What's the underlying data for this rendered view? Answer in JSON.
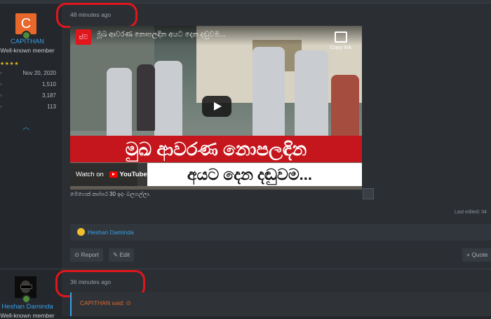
{
  "post1": {
    "time": "48 minutes ago",
    "user": {
      "avatar_letter": "C",
      "name": "CAPITHAN",
      "title": "Well-known member",
      "stars": "★★★★",
      "joined": "Nov 20, 2020",
      "messages": "1,510",
      "reactions": "3,187",
      "points": "113"
    },
    "video": {
      "channel_logo": "ස්‍ව",
      "title": "මූඛ ආවරණ නොපලඳින අයට දෙන දඬුවම...",
      "copy_link": "Copy link",
      "banner_line1": "මුඛ ආවරණ නොපලඳින",
      "banner_line2": "අයට දෙන දඬුවම...",
      "watch_on": "Watch on",
      "youtube": "YouTube"
    },
    "caption": "මෙහෙක් කප්පර 30 ඉදං බලගල්ලා.",
    "last_edited": "Last edited: 34",
    "reaction_user": "Heshan Daminda",
    "actions": {
      "report": "Report",
      "edit": "Edit",
      "quote": "+ Quote"
    }
  },
  "post2": {
    "time": "36 minutes ago",
    "user": {
      "name": "Heshan Daminda",
      "title": "Well-known member"
    },
    "quote_label": "CAPITHAN said: ⊙"
  },
  "colors": {
    "accent": "#3aa0e6",
    "highlight_ring": "#e0161c",
    "avatar_bg": "#e8672a"
  },
  "icons": [
    "collapse-chevron-icon",
    "report-icon",
    "edit-icon",
    "media-icon",
    "play-icon"
  ]
}
